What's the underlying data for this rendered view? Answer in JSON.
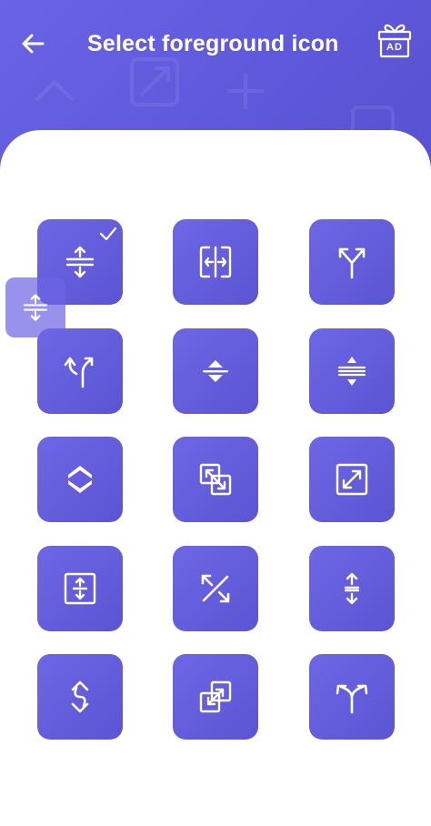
{
  "header": {
    "title": "Select foreground icon",
    "back_icon": "arrow-left-icon",
    "ad_icon": "gift-ad-icon",
    "ad_text": "AD",
    "background_color": "#6360df"
  },
  "grid": {
    "tile_color": "#6660e0",
    "selected_index": 0,
    "icons": [
      "expand-vertical-icon",
      "split-horizontal-icon",
      "merge-up-icon",
      "fork-right-icon",
      "collapse-vertical-icon",
      "expand-vertical-lines-icon",
      "chevrons-up-down-icon",
      "overlap-squares-icon",
      "expand-diagonal-icon",
      "expand-vertical-box-icon",
      "arrows-diagonal-icon",
      "split-vertical-icon",
      "arrow-vertical-curve-icon",
      "external-squares-icon",
      "fork-both-icon"
    ]
  },
  "preview": {
    "icon": "expand-vertical-icon"
  }
}
